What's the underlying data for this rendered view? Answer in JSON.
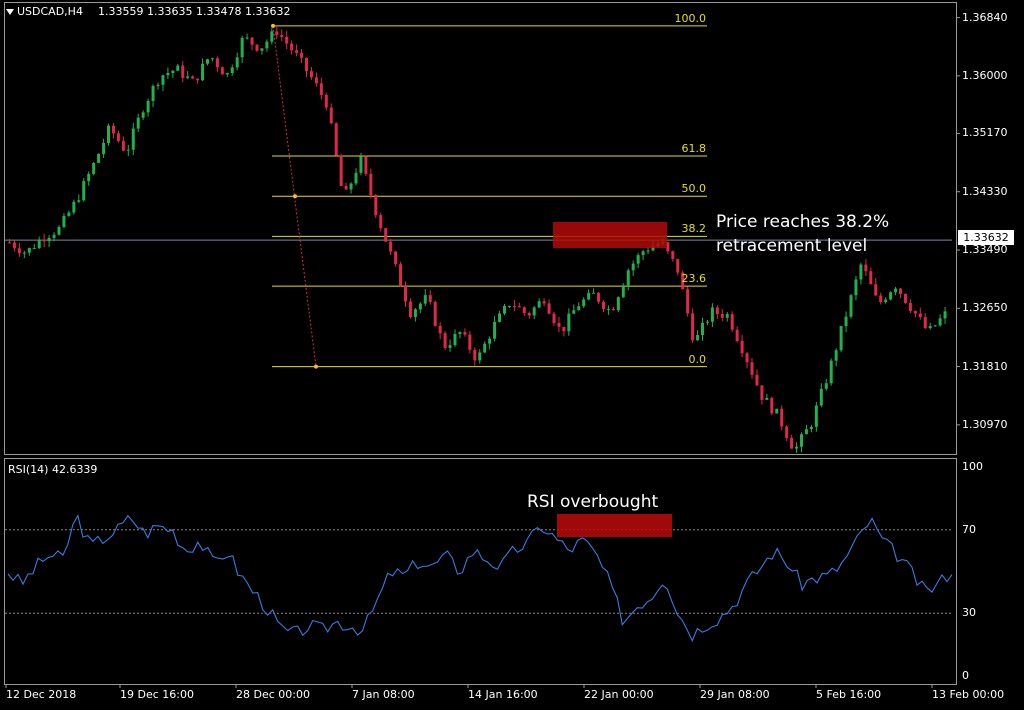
{
  "header": {
    "symbol": "USDCAD,H4",
    "ohlc": "1.33559 1.33635 1.33478 1.33632"
  },
  "rsi_header": {
    "label": "RSI(14) 42.6339"
  },
  "current_price_label": "1.33632",
  "colors": {
    "background": "#000000",
    "bull_candle": "#22b14c",
    "bear_candle": "#e0284a",
    "fib_line": "#e8e000",
    "rsi_line": "#3a7be0",
    "highlight_box": "#b00a0a"
  },
  "annotations": {
    "price_note_line1": "Price reaches 38.2%",
    "price_note_line2": "retracement level",
    "rsi_note": "RSI overbought"
  },
  "chart_data": [
    {
      "type": "candlestick",
      "title": "USDCAD,H4",
      "y_axis_ticks": [
        "1.36840",
        "1.36000",
        "1.35170",
        "1.34330",
        "1.33490",
        "1.32650",
        "1.31810",
        "1.30970"
      ],
      "ylim": [
        1.3055,
        1.3705
      ],
      "last_price": 1.33632,
      "fibonacci": {
        "high_price": 1.3672,
        "low_price": 1.3181,
        "levels": [
          {
            "label": "100.0",
            "ratio": 1.0
          },
          {
            "label": "61.8",
            "ratio": 0.618
          },
          {
            "label": "50.0",
            "ratio": 0.5
          },
          {
            "label": "38.2",
            "ratio": 0.382
          },
          {
            "label": "23.6",
            "ratio": 0.236
          },
          {
            "label": "0.0",
            "ratio": 0.0
          }
        ]
      },
      "close_path": [
        1.336,
        1.3345,
        1.3368,
        1.338,
        1.342,
        1.347,
        1.3525,
        1.349,
        1.3555,
        1.36,
        1.361,
        1.359,
        1.363,
        1.36,
        1.3655,
        1.364,
        1.3665,
        1.3635,
        1.36,
        1.356,
        1.342,
        1.348,
        1.34,
        1.333,
        1.326,
        1.328,
        1.321,
        1.323,
        1.319,
        1.324,
        1.3275,
        1.3255,
        1.328,
        1.323,
        1.327,
        1.3285,
        1.326,
        1.332,
        1.335,
        1.336,
        1.332,
        1.3215,
        1.326,
        1.3255,
        1.32,
        1.314,
        1.311,
        1.306,
        1.31,
        1.317,
        1.325,
        1.333,
        1.327,
        1.33,
        1.3265,
        1.323,
        1.3256
      ]
    },
    {
      "type": "line",
      "title": "RSI(14) 42.6339",
      "y_axis_ticks": [
        "100",
        "70",
        "30",
        "0"
      ],
      "ylim": [
        0,
        100
      ],
      "reference_levels": [
        70,
        30
      ],
      "path": [
        50,
        44,
        52,
        58,
        56,
        77,
        62,
        66,
        70,
        76,
        68,
        72,
        70,
        60,
        65,
        54,
        60,
        48,
        40,
        32,
        22,
        20,
        24,
        22,
        26,
        24,
        22,
        36,
        50,
        48,
        55,
        52,
        58,
        50,
        60,
        56,
        52,
        60,
        64,
        72,
        66,
        60,
        65,
        58,
        44,
        26,
        34,
        38,
        48,
        30,
        20,
        25,
        28,
        34,
        44,
        52,
        60,
        54,
        44,
        47,
        48,
        54,
        64,
        75,
        64,
        58,
        50,
        40,
        44,
        51
      ],
      "x_ticks": [
        "12 Dec 2018",
        "19 Dec 16:00",
        "28 Dec 00:00",
        "7 Jan 08:00",
        "14 Jan 16:00",
        "22 Jan 00:00",
        "29 Jan 08:00",
        "5 Feb 16:00",
        "13 Feb 00:00"
      ]
    }
  ]
}
